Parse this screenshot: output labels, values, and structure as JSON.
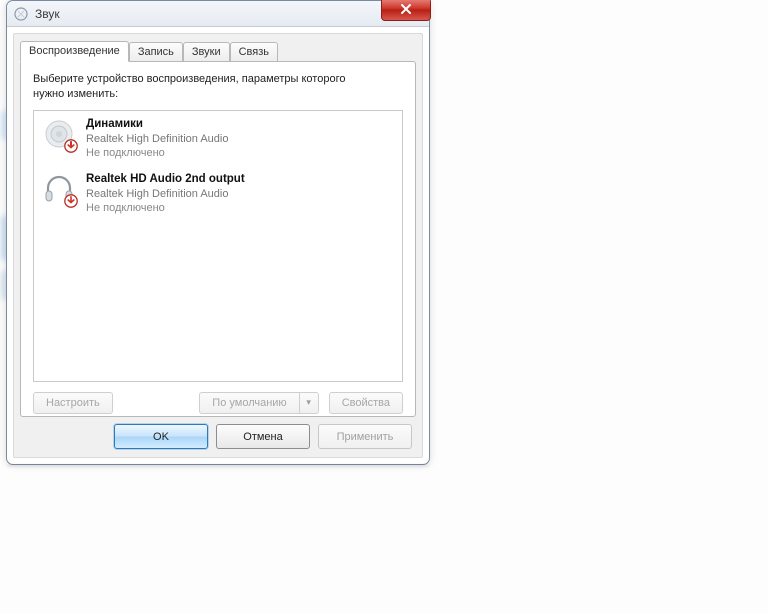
{
  "window": {
    "title": "Звук"
  },
  "tabs": [
    {
      "label": "Воспроизведение",
      "active": true
    },
    {
      "label": "Запись"
    },
    {
      "label": "Звуки"
    },
    {
      "label": "Связь"
    }
  ],
  "instruction_line1": "Выберите устройство воспроизведения, параметры которого",
  "instruction_line2": "нужно изменить:",
  "devices": [
    {
      "name": "Динамики",
      "driver": "Realtek High Definition Audio",
      "status": "Не подключено",
      "icon": "speaker"
    },
    {
      "name": "Realtek HD Audio 2nd output",
      "driver": "Realtek High Definition Audio",
      "status": "Не подключено",
      "icon": "headphones"
    }
  ],
  "buttons": {
    "configure": "Настроить",
    "set_default": "По умолчанию",
    "properties": "Свойства",
    "ok": "OK",
    "cancel": "Отмена",
    "apply": "Применить"
  }
}
